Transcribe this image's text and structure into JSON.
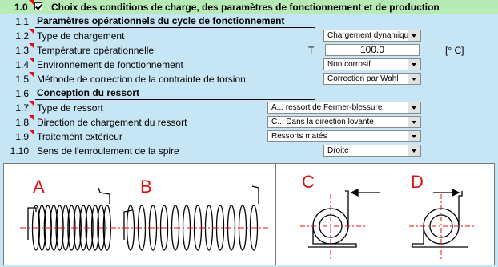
{
  "header": {
    "number": "1.0",
    "title": "Choix des conditions de charge, des paramètres de fonctionnement et de production"
  },
  "rows": [
    {
      "num": "1.1",
      "label": "Paramètres opérationnels du cycle de fonctionnement",
      "bold": true
    },
    {
      "num": "1.2",
      "label": "Type de chargement",
      "value": "Chargement dynamique"
    },
    {
      "num": "1.3",
      "label": "Température opérationnelle",
      "symbol": "T",
      "value": "100.0",
      "unit": "[° C]"
    },
    {
      "num": "1.4",
      "label": "Environnement de fonctionnement",
      "value": "Non corrosif"
    },
    {
      "num": "1.5",
      "label": "Méthode de correction de la contrainte de torsion",
      "value": "Correction par Wahl"
    },
    {
      "num": "1.6",
      "label": "Conception du ressort",
      "bold": true
    },
    {
      "num": "1.7",
      "label": "Type de ressort",
      "value": "A... ressort de Fermer-blessure"
    },
    {
      "num": "1.8",
      "label": "Direction de chargement du ressort",
      "value": "C... Dans la direction lovante"
    },
    {
      "num": "1.9",
      "label": "Traitement extérieur",
      "value": "Ressorts matés"
    },
    {
      "num": "1.10",
      "label": "Sens de l'enroulement de la spire",
      "value": "Droite"
    }
  ],
  "figures": {
    "a": "A",
    "b": "B",
    "c": "C",
    "d": "D"
  },
  "colors": {
    "background": "#c6e6f6",
    "header": "#b6ebb6",
    "letters": "#e01010"
  }
}
